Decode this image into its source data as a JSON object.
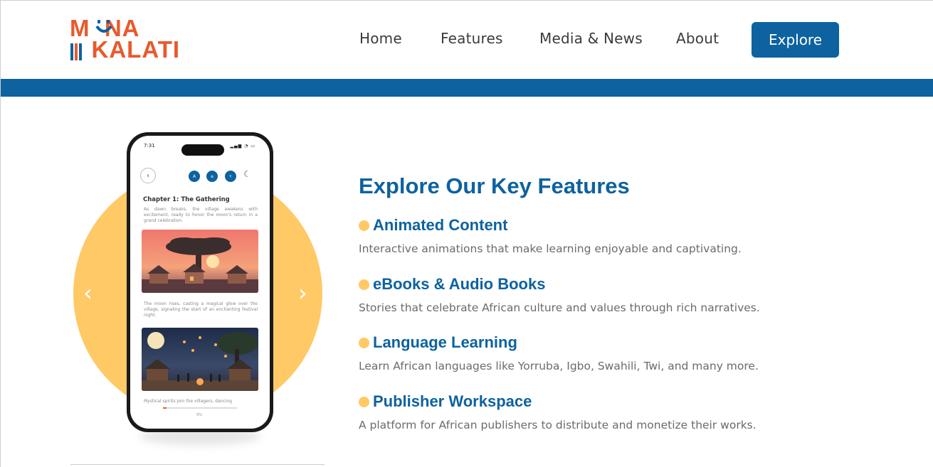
{
  "brand": {
    "logo_line1": "MUNA",
    "logo_line2": "KALATI",
    "logo_color": "#e85a2b"
  },
  "nav": {
    "home": "Home",
    "features": "Features",
    "media": "Media & News",
    "about": "About",
    "explore": "Explore"
  },
  "colors": {
    "primary": "#0d629f",
    "accent": "#ffc966",
    "text_muted": "#6b6b6b"
  },
  "carousel": {
    "prev_icon": "chevron-left-icon",
    "next_icon": "chevron-right-icon",
    "prev": "‹",
    "next": "›"
  },
  "phone": {
    "time": "7:31",
    "status_icons": "signal wifi battery",
    "controls": [
      "A",
      "a",
      "ঽ"
    ],
    "chapter_title": "Chapter 1: The Gathering",
    "para1": "As dawn breaks, the village awakens with excitement, ready to honor the moon's return in a grand celebration.",
    "para2": "The moon rises, casting a magical glow over the village, signaling the start of an enchanting festival night.",
    "para3": "Mystical spirits join the villagers, dancing",
    "progress_label": "5%",
    "progress": 0.05
  },
  "features": {
    "title": "Explore Our Key Features",
    "items": [
      {
        "title": "Animated Content",
        "desc": "Interactive animations that make learning enjoyable and captivating."
      },
      {
        "title": "eBooks & Audio Books",
        "desc": "Stories that celebrate African culture and values through rich narratives."
      },
      {
        "title": "Language Learning",
        "desc": "Learn African languages like Yorruba, Igbo, Swahili, Twi, and many more."
      },
      {
        "title": "Publisher Workspace",
        "desc": "A platform for African publishers to distribute and monetize their works."
      }
    ]
  }
}
